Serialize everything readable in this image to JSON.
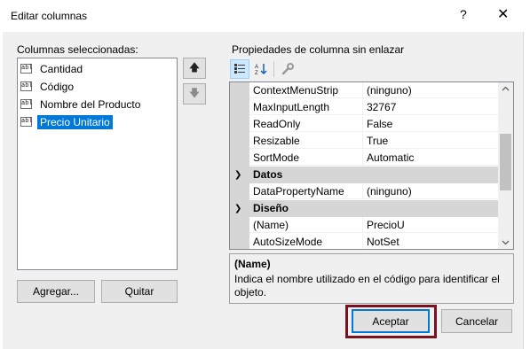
{
  "window": {
    "title": "Editar columnas",
    "help": "?",
    "close": "✕"
  },
  "left": {
    "label": "Columnas seleccionadas:",
    "icon_text": "abl",
    "items": [
      {
        "label": "Cantidad",
        "selected": false
      },
      {
        "label": "Código",
        "selected": false
      },
      {
        "label": "Nombre del Producto",
        "selected": false
      },
      {
        "label": "Precio Unitario",
        "selected": true
      }
    ],
    "move_up": "🡅",
    "move_down": "🡇",
    "add_label": "Agregar...",
    "remove_label": "Quitar"
  },
  "right": {
    "label": "Propiedades de columna sin enlazar",
    "toolbar_icons": [
      "categorized-icon",
      "alphabetical-icon",
      "property-pages-icon"
    ],
    "grid": [
      {
        "type": "prop",
        "name": "ContextMenuStrip",
        "value": "(ninguno)"
      },
      {
        "type": "prop",
        "name": "MaxInputLength",
        "value": "32767"
      },
      {
        "type": "prop",
        "name": "ReadOnly",
        "value": "False"
      },
      {
        "type": "prop",
        "name": "Resizable",
        "value": "True"
      },
      {
        "type": "prop",
        "name": "SortMode",
        "value": "Automatic"
      },
      {
        "type": "cat",
        "name": "Datos"
      },
      {
        "type": "prop",
        "name": "DataPropertyName",
        "value": "(ninguno)"
      },
      {
        "type": "cat",
        "name": "Diseño"
      },
      {
        "type": "prop",
        "name": "(Name)",
        "value": "PrecioU"
      },
      {
        "type": "prop",
        "name": "AutoSizeMode",
        "value": "NotSet"
      }
    ],
    "description": {
      "title": "(Name)",
      "text": "Indica el nombre utilizado en el código para identificar el objeto."
    }
  },
  "footer": {
    "ok_label": "Aceptar",
    "cancel_label": "Cancelar"
  },
  "colors": {
    "selection": "#0078d7",
    "highlight_frame": "#7b1020",
    "category": "#d6d6d6"
  }
}
